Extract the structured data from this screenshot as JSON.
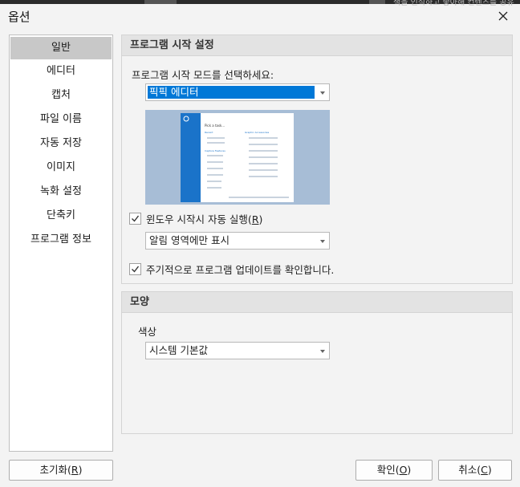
{
  "window": {
    "title": "옵션",
    "background_snippet": "색을 인식하고 좋아해 컨텐츠를 공유"
  },
  "sidebar": {
    "items": [
      {
        "label": "일반",
        "selected": true
      },
      {
        "label": "에디터"
      },
      {
        "label": "캡처"
      },
      {
        "label": "파일 이름"
      },
      {
        "label": "자동 저장"
      },
      {
        "label": "이미지"
      },
      {
        "label": "녹화 설정"
      },
      {
        "label": "단축키"
      },
      {
        "label": "프로그램 정보"
      }
    ]
  },
  "startup": {
    "header": "프로그램 시작 설정",
    "mode_label": "프로그램 시작 모드를 선택하세요:",
    "mode_value": "픽픽 에디터",
    "autorun_label": "윈도우 시작시 자동 실행(",
    "autorun_key": "R",
    "autorun_close": ")",
    "autorun_checked": true,
    "tray_value": "알림 영역에만 표시",
    "update_label": "주기적으로 프로그램 업데이트를 확인합니다.",
    "update_checked": true
  },
  "preview": {
    "heading": "Pick a task...",
    "col1": "Recent",
    "col2": "Capture Features",
    "col3": "Graphic Accessories"
  },
  "appearance": {
    "header": "모양",
    "color_label": "색상",
    "color_value": "시스템 기본값"
  },
  "buttons": {
    "reset": "초기화(",
    "reset_key": "R",
    "ok": "확인(",
    "ok_key": "O",
    "cancel": "취소(",
    "cancel_key": "C",
    "close_paren": ")"
  },
  "colors": {
    "accent": "#0078d7",
    "selected_nav": "#c8c8c8",
    "panel_header": "#e3e3e3"
  }
}
